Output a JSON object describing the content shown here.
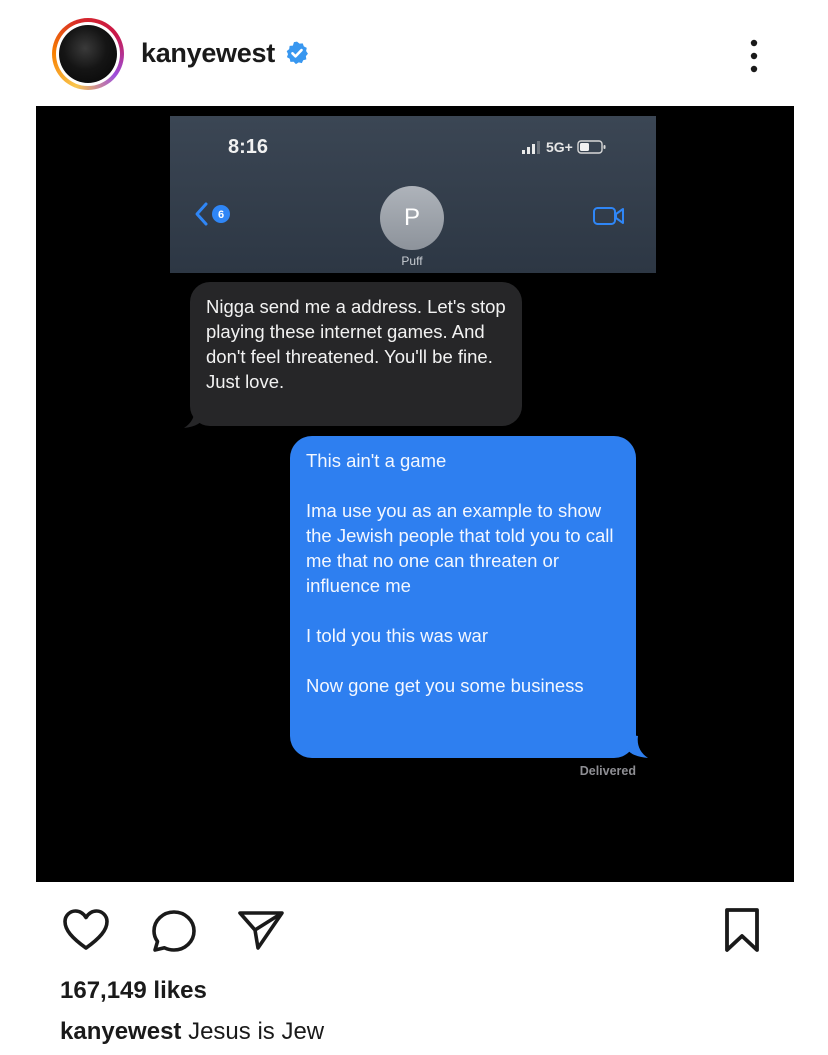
{
  "post": {
    "username": "kanyewest",
    "verified": true,
    "more_icon": "more-vertical-icon"
  },
  "screenshot": {
    "status_bar": {
      "time": "8:16",
      "network": "5G+"
    },
    "header": {
      "back_count": "6",
      "contact_initial": "P",
      "contact_name": "Puff"
    },
    "incoming_message": "Nigga send me a address. Let's stop playing these internet games. And don't feel threatened. You'll be fine.  Just love.",
    "outgoing_message": [
      "This ain't a game",
      "Ima use you as an example to show the Jewish people that told you to call me that no one can threaten or influence me",
      "I told you this was war",
      "Now gone get you some business"
    ],
    "delivered_label": "Delivered",
    "colors": {
      "outgoing": "#2e7ff0",
      "incoming": "#262628",
      "ios_blue": "#2f86f6"
    }
  },
  "actions": {
    "icons": [
      "heart-icon",
      "comment-icon",
      "share-icon",
      "bookmark-icon"
    ]
  },
  "likes": "167,149 likes",
  "caption": {
    "username": "kanyewest",
    "text": "Jesus is Jew"
  }
}
